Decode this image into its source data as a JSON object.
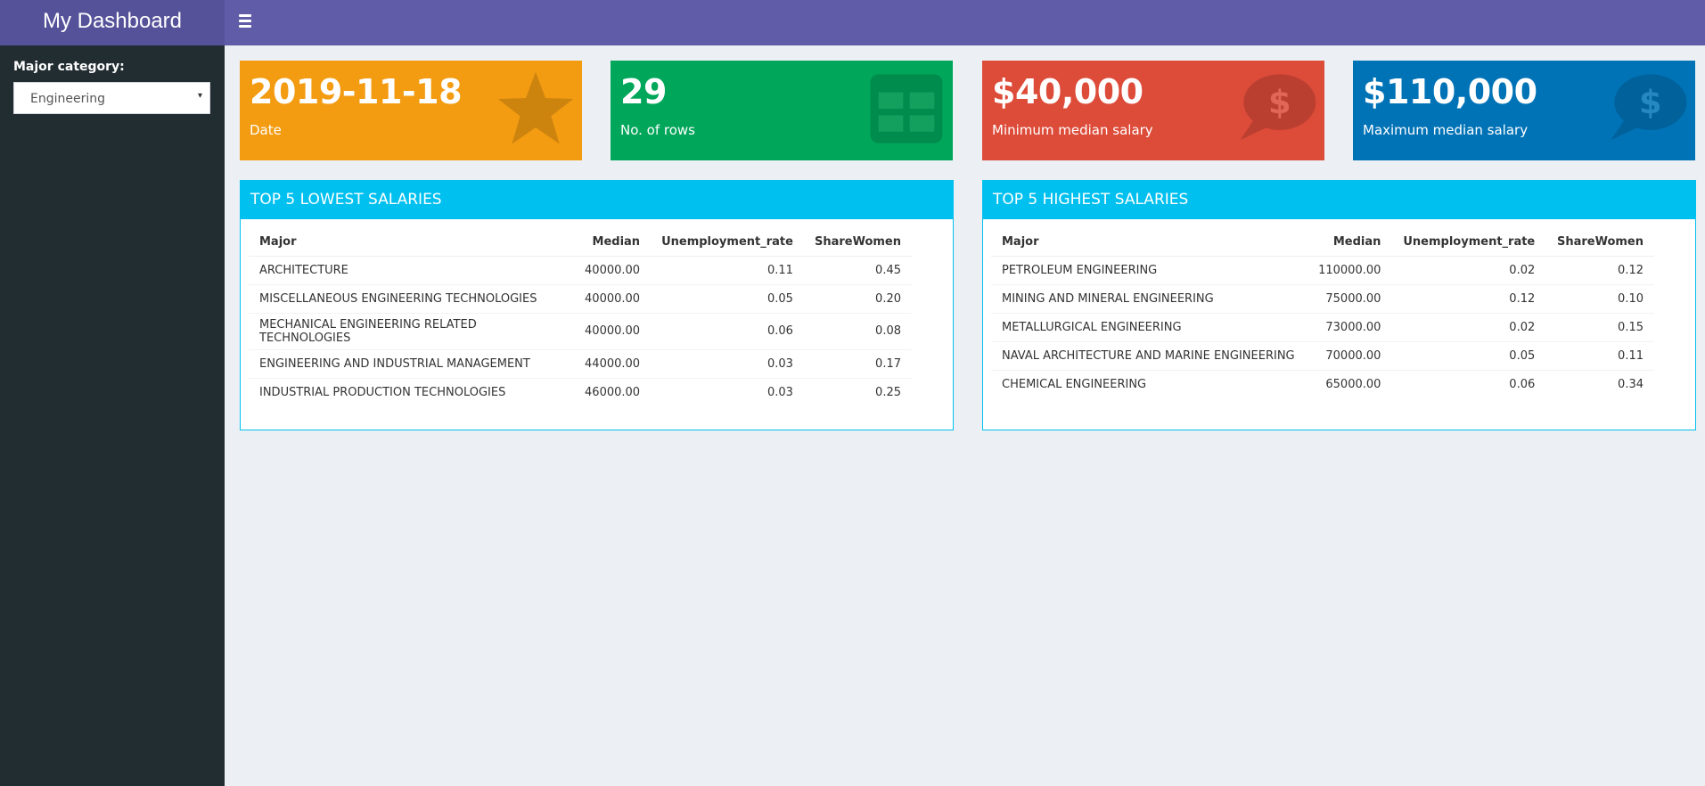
{
  "header": {
    "title": "My Dashboard",
    "menu_icon": "hamburger-icon"
  },
  "sidebar": {
    "label": "Major category:",
    "select_value": "Engineering",
    "caret": "▾"
  },
  "valueboxes": [
    {
      "value": "2019-11-18",
      "subtitle": "Date",
      "color": "#f39c12",
      "icon": "star-icon"
    },
    {
      "value": "29",
      "subtitle": "No. of rows",
      "color": "#00a65a",
      "icon": "table-icon"
    },
    {
      "value": "$40,000",
      "subtitle": "Minimum median salary",
      "color": "#dd4b39",
      "icon": "dollar-chat-icon"
    },
    {
      "value": "$110,000",
      "subtitle": "Maximum median salary",
      "color": "#0073b7",
      "icon": "dollar-chat-icon"
    }
  ],
  "boxes": [
    {
      "title": "TOP 5 LOWEST SALARIES",
      "columns": [
        "Major",
        "Median",
        "Unemployment_rate",
        "ShareWomen"
      ],
      "rows": [
        [
          "ARCHITECTURE",
          "40000.00",
          "0.11",
          "0.45"
        ],
        [
          "MISCELLANEOUS ENGINEERING TECHNOLOGIES",
          "40000.00",
          "0.05",
          "0.20"
        ],
        [
          "MECHANICAL ENGINEERING RELATED TECHNOLOGIES",
          "40000.00",
          "0.06",
          "0.08"
        ],
        [
          "ENGINEERING AND INDUSTRIAL MANAGEMENT",
          "44000.00",
          "0.03",
          "0.17"
        ],
        [
          "INDUSTRIAL PRODUCTION TECHNOLOGIES",
          "46000.00",
          "0.03",
          "0.25"
        ]
      ]
    },
    {
      "title": "TOP 5 HIGHEST SALARIES",
      "columns": [
        "Major",
        "Median",
        "Unemployment_rate",
        "ShareWomen"
      ],
      "rows": [
        [
          "PETROLEUM ENGINEERING",
          "110000.00",
          "0.02",
          "0.12"
        ],
        [
          "MINING AND MINERAL ENGINEERING",
          "75000.00",
          "0.12",
          "0.10"
        ],
        [
          "METALLURGICAL ENGINEERING",
          "73000.00",
          "0.02",
          "0.15"
        ],
        [
          "NAVAL ARCHITECTURE AND MARINE ENGINEERING",
          "70000.00",
          "0.05",
          "0.11"
        ],
        [
          "CHEMICAL ENGINEERING",
          "65000.00",
          "0.06",
          "0.34"
        ]
      ]
    }
  ]
}
